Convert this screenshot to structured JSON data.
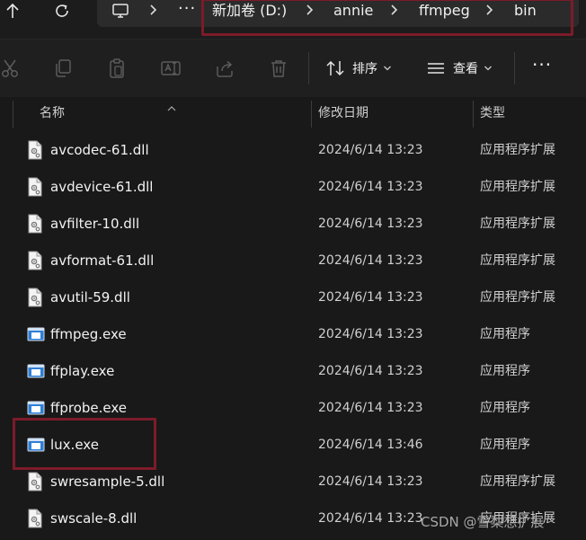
{
  "breadcrumb": {
    "items": [
      "新加卷 (D:)",
      "annie",
      "ffmpeg",
      "bin"
    ],
    "more_glyph": "···"
  },
  "toolbar": {
    "sort_label": "排序",
    "view_label": "查看",
    "more_glyph": "···",
    "icons": [
      "cut-icon",
      "copy-icon",
      "paste-icon",
      "rename-icon",
      "share-icon",
      "delete-icon"
    ]
  },
  "columns": {
    "name": "名称",
    "modified": "修改日期",
    "type": "类型"
  },
  "files": [
    {
      "name": "avcodec-61.dll",
      "date": "2024/6/14 13:23",
      "type": "应用程序扩展",
      "kind": "dll"
    },
    {
      "name": "avdevice-61.dll",
      "date": "2024/6/14 13:23",
      "type": "应用程序扩展",
      "kind": "dll"
    },
    {
      "name": "avfilter-10.dll",
      "date": "2024/6/14 13:23",
      "type": "应用程序扩展",
      "kind": "dll"
    },
    {
      "name": "avformat-61.dll",
      "date": "2024/6/14 13:23",
      "type": "应用程序扩展",
      "kind": "dll"
    },
    {
      "name": "avutil-59.dll",
      "date": "2024/6/14 13:23",
      "type": "应用程序扩展",
      "kind": "dll"
    },
    {
      "name": "ffmpeg.exe",
      "date": "2024/6/14 13:23",
      "type": "应用程序",
      "kind": "exe"
    },
    {
      "name": "ffplay.exe",
      "date": "2024/6/14 13:23",
      "type": "应用程序",
      "kind": "exe"
    },
    {
      "name": "ffprobe.exe",
      "date": "2024/6/14 13:23",
      "type": "应用程序",
      "kind": "exe"
    },
    {
      "name": "lux.exe",
      "date": "2024/6/14 13:46",
      "type": "应用程序",
      "kind": "exe"
    },
    {
      "name": "swresample-5.dll",
      "date": "2024/6/14 13:23",
      "type": "应用程序扩展",
      "kind": "dll"
    },
    {
      "name": "swscale-8.dll",
      "date": "2024/6/14 13:23",
      "type": "应用程序扩展",
      "kind": "dll"
    }
  ],
  "watermark": "CSDN @雪梨想扩展",
  "colors": {
    "highlight": "#7c1b2a",
    "background": "#191919"
  }
}
